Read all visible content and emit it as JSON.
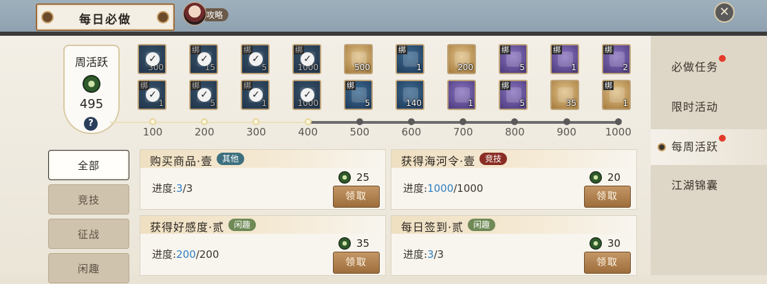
{
  "header": {
    "title": "每日必做",
    "guide_label": "攻略",
    "close_glyph": "✕"
  },
  "activity": {
    "title": "周活跃",
    "score": "495",
    "help_glyph": "?"
  },
  "track": {
    "milestones": [
      "100",
      "200",
      "300",
      "400",
      "500",
      "600",
      "700",
      "800",
      "900",
      "1000"
    ],
    "reached_count": 4,
    "top_rewards": [
      {
        "bound": "",
        "qty": "300",
        "style": "blue",
        "claimed": true
      },
      {
        "bound": "绑",
        "qty": "15",
        "style": "blue",
        "claimed": true
      },
      {
        "bound": "绑",
        "qty": "5",
        "style": "blue",
        "claimed": true
      },
      {
        "bound": "绑",
        "qty": "1000",
        "style": "blue",
        "claimed": true
      },
      {
        "bound": "",
        "qty": "500",
        "style": "gold",
        "claimed": false
      },
      {
        "bound": "绑",
        "qty": "1",
        "style": "blue",
        "claimed": false
      },
      {
        "bound": "",
        "qty": "200",
        "style": "gold",
        "claimed": false
      },
      {
        "bound": "绑",
        "qty": "5",
        "style": "purple",
        "claimed": false
      },
      {
        "bound": "绑",
        "qty": "1",
        "style": "purple",
        "claimed": false
      },
      {
        "bound": "绑",
        "qty": "2",
        "style": "purple",
        "claimed": false
      }
    ],
    "bottom_rewards": [
      {
        "bound": "绑",
        "qty": "1",
        "style": "blue",
        "claimed": true
      },
      {
        "bound": "绑",
        "qty": "5",
        "style": "blue",
        "claimed": true
      },
      {
        "bound": "绑",
        "qty": "1",
        "style": "blue",
        "claimed": true
      },
      {
        "bound": "",
        "qty": "1000",
        "style": "blue",
        "claimed": true
      },
      {
        "bound": "绑",
        "qty": "5",
        "style": "blue",
        "claimed": false
      },
      {
        "bound": "",
        "qty": "140",
        "style": "blue",
        "claimed": false
      },
      {
        "bound": "",
        "qty": "1",
        "style": "purple",
        "claimed": false
      },
      {
        "bound": "绑",
        "qty": "5",
        "style": "purple",
        "claimed": false
      },
      {
        "bound": "",
        "qty": "35",
        "style": "gold",
        "claimed": false
      },
      {
        "bound": "绑",
        "qty": "1",
        "style": "gold",
        "claimed": false
      }
    ]
  },
  "categories": [
    "全部",
    "竞技",
    "征战",
    "闲趣"
  ],
  "tasks": [
    {
      "title": "购买商品·壹",
      "tag": "其他",
      "tag_style": "teal",
      "progress_label": "进度:",
      "current": "3",
      "total": "/3",
      "points": "25",
      "claim": "领取"
    },
    {
      "title": "获得海河令·壹",
      "tag": "竞技",
      "tag_style": "red",
      "progress_label": "进度:",
      "current": "1000",
      "total": "/1000",
      "points": "20",
      "claim": "领取"
    },
    {
      "title": "获得好感度·贰",
      "tag": "闲趣",
      "tag_style": "olive",
      "progress_label": "进度:",
      "current": "200",
      "total": "/200",
      "points": "35",
      "claim": "领取"
    },
    {
      "title": "每日签到·贰",
      "tag": "闲趣",
      "tag_style": "olive",
      "progress_label": "进度:",
      "current": "3",
      "total": "/3",
      "points": "30",
      "claim": "领取"
    }
  ],
  "sidebar": {
    "items": [
      {
        "label": "必做任务",
        "has_dot": true,
        "active": false
      },
      {
        "label": "限时活动",
        "has_dot": false,
        "active": false
      },
      {
        "label": "每周活跃",
        "has_dot": true,
        "active": true
      },
      {
        "label": "江湖锦囊",
        "has_dot": false,
        "active": false
      }
    ]
  },
  "colors": {
    "accent_red": "#e23b2b",
    "progress_blue": "#2f7fc0",
    "claim_brown": "#9e6d3c"
  }
}
